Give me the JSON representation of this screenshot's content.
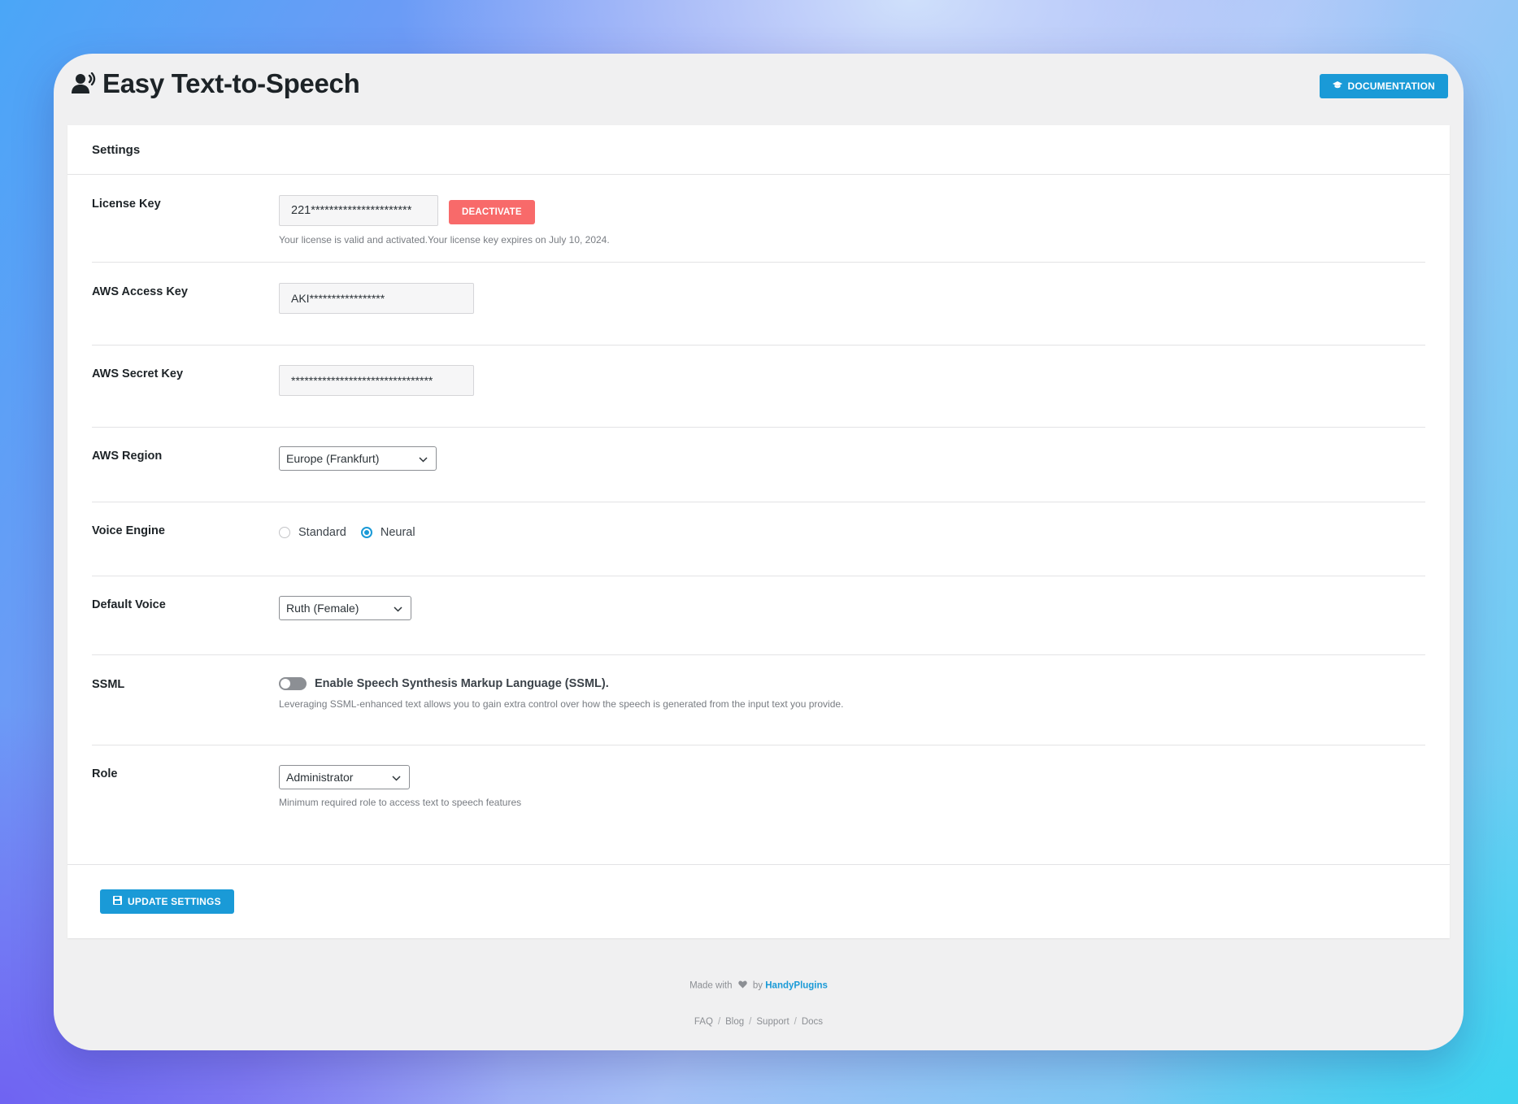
{
  "app": {
    "title": "Easy Text-to-Speech",
    "documentation_label": "DOCUMENTATION"
  },
  "card": {
    "header": "Settings"
  },
  "license": {
    "label": "License Key",
    "value": "221**********************",
    "deactivate_label": "DEACTIVATE",
    "description": "Your license is valid and activated.Your license key expires on July 10, 2024."
  },
  "aws_access": {
    "label": "AWS Access Key",
    "value": "AKI*****************"
  },
  "aws_secret": {
    "label": "AWS Secret Key",
    "value": "********************************"
  },
  "aws_region": {
    "label": "AWS Region",
    "selected": "Europe (Frankfurt)"
  },
  "voice_engine": {
    "label": "Voice Engine",
    "options": [
      "Standard",
      "Neural"
    ],
    "selected": "Neural"
  },
  "default_voice": {
    "label": "Default Voice",
    "selected": "Ruth (Female)"
  },
  "ssml": {
    "label": "SSML",
    "toggle_label": "Enable Speech Synthesis Markup Language (SSML).",
    "enabled": false,
    "description": "Leveraging SSML-enhanced text allows you to gain extra control over how the speech is generated from the input text you provide."
  },
  "role": {
    "label": "Role",
    "selected": "Administrator",
    "description": "Minimum required role to access text to speech features"
  },
  "update_label": "UPDATE SETTINGS",
  "footer": {
    "made_with": "Made with",
    "by": "by",
    "brand": "HandyPlugins",
    "links": [
      "FAQ",
      "Blog",
      "Support",
      "Docs"
    ],
    "separator": "/"
  },
  "colors": {
    "accent": "#1a9ad7",
    "danger": "#f86a6a"
  }
}
